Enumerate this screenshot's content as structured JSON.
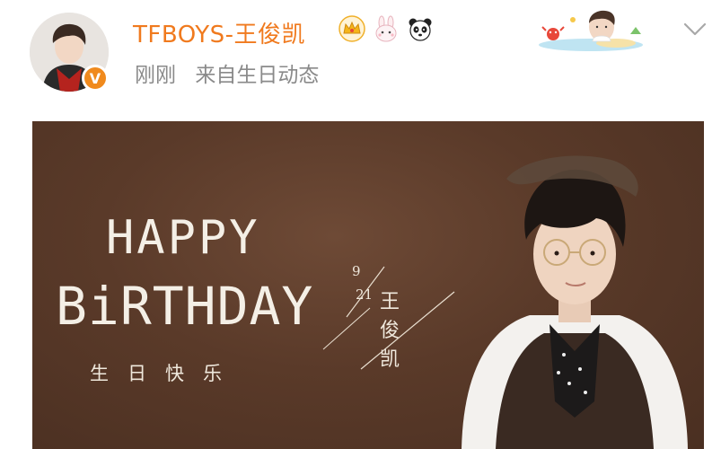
{
  "post": {
    "username": "TFBOYS-王俊凯",
    "verified_badge": "V",
    "time": "刚刚",
    "source": "来自生日动态",
    "badges": [
      "crown-icon",
      "bunny-icon",
      "panda-icon"
    ]
  },
  "banner": {
    "line1": "HAPPY",
    "line2": "BiRTHDAY",
    "wish": "生日快乐",
    "month": "9",
    "day": "21",
    "name_chars": [
      "王",
      "俊",
      "凯"
    ]
  },
  "colors": {
    "username": "#f07a1e",
    "meta": "#8a8a8a",
    "banner_bg": "#5a3a29",
    "banner_text": "#f4efe6",
    "vbadge": "#f08a1d"
  }
}
